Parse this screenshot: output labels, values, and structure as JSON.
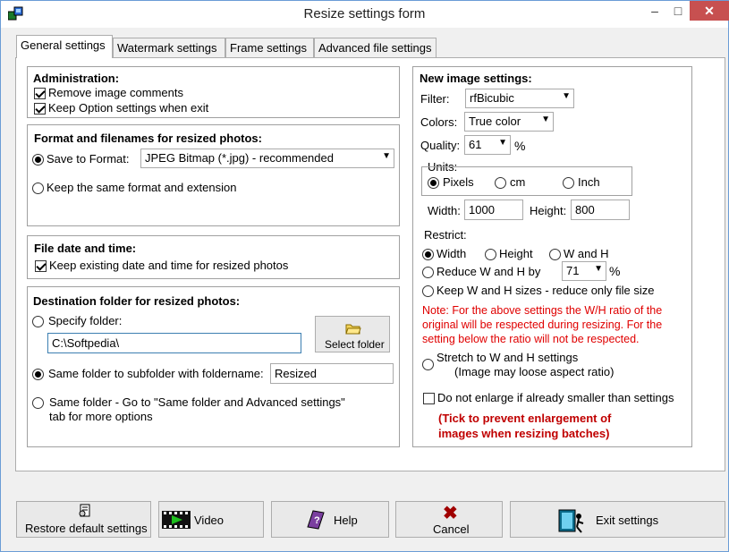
{
  "window": {
    "title": "Resize settings form",
    "controls": {
      "minimize": "–",
      "maximize": "□",
      "close": "✕"
    }
  },
  "tabs": [
    {
      "label": "General settings",
      "active": true
    },
    {
      "label": "Watermark settings",
      "active": false
    },
    {
      "label": "Frame settings",
      "active": false
    },
    {
      "label": "Advanced file settings",
      "active": false
    }
  ],
  "administration": {
    "heading": "Administration:",
    "remove_comments": "Remove image comments",
    "keep_option": "Keep Option settings when exit"
  },
  "format": {
    "heading": "Format and filenames for resized photos:",
    "save_to_format": "Save to Format:",
    "format_value": "JPEG Bitmap (*.jpg) - recommended",
    "keep_same": "Keep the same format and extension"
  },
  "filedate": {
    "heading": "File date and time:",
    "keep_date": "Keep existing date and time for resized photos"
  },
  "destination": {
    "heading": "Destination folder for resized photos:",
    "specify_folder": "Specify folder:",
    "folder_value": "C:\\Softpedia\\",
    "select_folder_button": "Select folder",
    "same_subfolder": "Same folder  to subfolder with foldername:",
    "subfolder_value": "Resized",
    "same_folder_goto": "Same folder - Go to  \"Same folder and Advanced settings\"",
    "tab_more": "tab for more options"
  },
  "new_image": {
    "heading": "New image settings:",
    "filter_label": "Filter:",
    "filter_value": "rfBicubic",
    "colors_label": "Colors:",
    "colors_value": "True color",
    "quality_label": "Quality:",
    "quality_value": "61",
    "quality_unit": "%",
    "units_label": "Units:",
    "units": {
      "pixels": "Pixels",
      "cm": "cm",
      "inch": "Inch"
    },
    "width_label": "Width:",
    "width_value": "1000",
    "height_label": "Height:",
    "height_value": "800",
    "restrict_label": "Restrict:",
    "restrict": {
      "width": "Width",
      "height": "Height",
      "wh": "W and H"
    },
    "reduce_label": "Reduce W and H by",
    "reduce_value": "71",
    "reduce_unit": "%",
    "keep_wh": "Keep W and H sizes - reduce only file size",
    "note_lines": [
      "Note:  For the above settings the W/H ratio of the",
      "original will be respected during resizing.  For the",
      "setting below the ratio will not be respected."
    ],
    "stretch_label": "Stretch to W and H settings",
    "stretch_sub": "(Image may loose aspect ratio)",
    "no_enlarge": "Do not enlarge if already smaller than settings",
    "tick_lines": [
      "(Tick to prevent enlargement of",
      "images when resizing batches)"
    ]
  },
  "buttons": {
    "restore": "Restore default settings",
    "video": "Video",
    "help": "Help",
    "cancel": "Cancel",
    "exit": "Exit settings"
  },
  "colors": {
    "note_red": "#e00000",
    "tick_red": "#c00000",
    "close_red": "#c75050",
    "border_blue": "#6b9cd6"
  }
}
